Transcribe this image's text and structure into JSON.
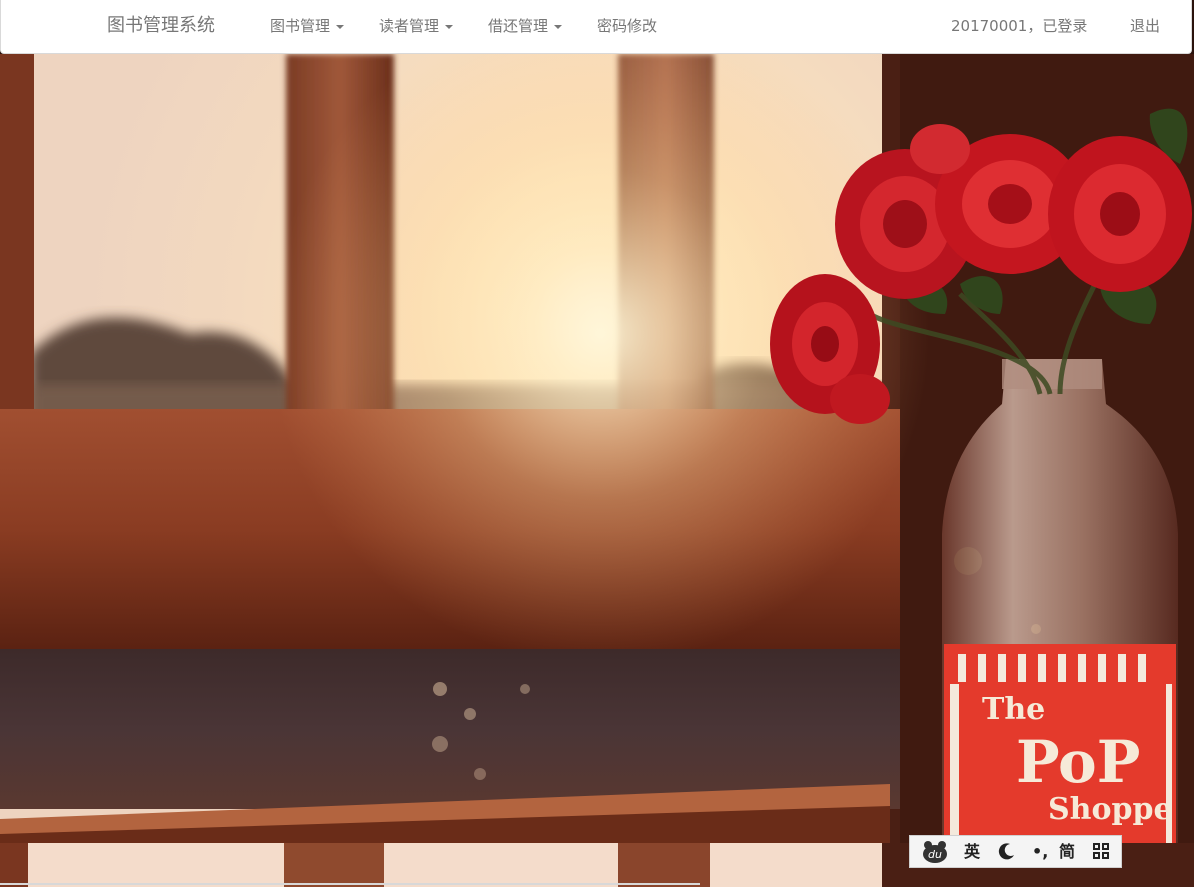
{
  "navbar": {
    "brand": "图书管理系统",
    "menus": [
      {
        "label": "图书管理",
        "dropdown": true
      },
      {
        "label": "读者管理",
        "dropdown": true
      },
      {
        "label": "借还管理",
        "dropdown": true
      },
      {
        "label": "密码修改",
        "dropdown": false
      }
    ],
    "user_status": "20170001，已登录",
    "logout": "退出"
  },
  "background": {
    "description_free": true,
    "bottle_label": {
      "line1": "The",
      "line2": "PoP",
      "line3": "Shoppe"
    }
  },
  "ime_toolbar": {
    "logo": "du",
    "lang": "英",
    "moon_icon": "moon-icon",
    "punct": "•,",
    "charset": "简",
    "grid_icon": "grid-icon"
  },
  "colors": {
    "nav_text": "#777777",
    "rose": "#c81e2a",
    "label_red": "#e8322c"
  }
}
